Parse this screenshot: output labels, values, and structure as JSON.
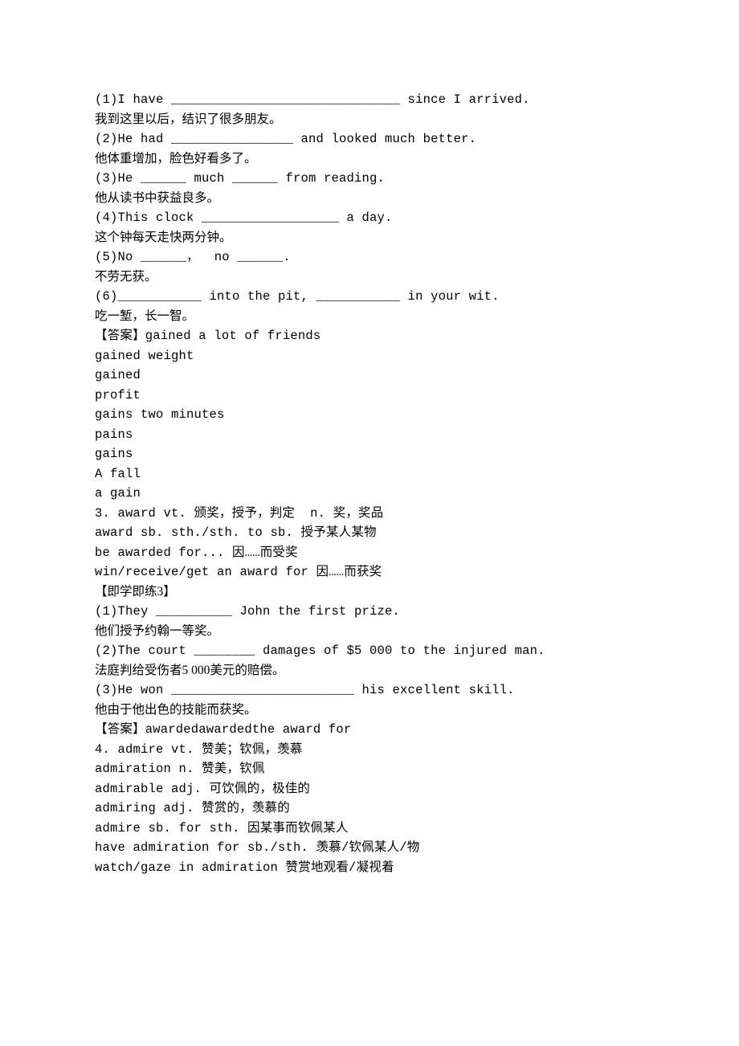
{
  "lines": [
    {
      "text": "(1)I have ______________________________ since I arrived.",
      "cls": "mono"
    },
    {
      "text": "我到这里以后，结识了很多朋友。",
      "cls": "cn"
    },
    {
      "text": "(2)He had ________________ and looked much better.",
      "cls": "mono"
    },
    {
      "text": "他体重增加，脸色好看多了。",
      "cls": "cn"
    },
    {
      "text": "(3)He ______ much ______ from reading.",
      "cls": "mono"
    },
    {
      "text": "他从读书中获益良多。",
      "cls": "cn"
    },
    {
      "text": "(4)This clock __________________ a day.",
      "cls": "mono"
    },
    {
      "text": "这个钟每天走快两分钟。",
      "cls": "cn"
    },
    {
      "text": "(5)No ______，  no ______.",
      "cls": "mono"
    },
    {
      "text": "不劳无获。",
      "cls": "cn"
    },
    {
      "text": "(6)___________ into the pit, ___________ in your wit.",
      "cls": "mono"
    },
    {
      "text": "吃一堑，长一智。",
      "cls": "cn"
    },
    {
      "text": "【答案】gained a lot of friends",
      "cls": "mono"
    },
    {
      "text": "gained weight",
      "cls": "mono"
    },
    {
      "text": "gained",
      "cls": "mono"
    },
    {
      "text": "profit",
      "cls": "mono"
    },
    {
      "text": "gains two minutes",
      "cls": "mono"
    },
    {
      "text": "pains",
      "cls": "mono"
    },
    {
      "text": "gains",
      "cls": "mono"
    },
    {
      "text": "A fall",
      "cls": "mono"
    },
    {
      "text": "a gain",
      "cls": "mono"
    },
    {
      "text": "",
      "cls": "mono"
    },
    {
      "text": "3. award vt. 颁奖，授予，判定  n. 奖，奖品",
      "cls": "mono"
    },
    {
      "text": "award sb. sth./sth. to sb. 授予某人某物",
      "cls": "mono"
    },
    {
      "text": "be awarded for... 因……而受奖",
      "cls": "mono"
    },
    {
      "text": "win/receive/get an award for 因……而获奖",
      "cls": "mono"
    },
    {
      "text": "",
      "cls": "mono"
    },
    {
      "text": "【即学即练3】",
      "cls": "cn"
    },
    {
      "text": "(1)They __________ John the first prize.",
      "cls": "mono"
    },
    {
      "text": "他们授予约翰一等奖。",
      "cls": "cn"
    },
    {
      "text": "(2)The court ________ damages of $5 000 to the injured man.",
      "cls": "mono"
    },
    {
      "text": "法庭判给受伤者5 000美元的赔偿。",
      "cls": "cn"
    },
    {
      "text": "(3)He won ________________________ his excellent skill.",
      "cls": "mono"
    },
    {
      "text": "他由于他出色的技能而获奖。",
      "cls": "cn"
    },
    {
      "text": "【答案】awardedawardedthe award for",
      "cls": "mono"
    },
    {
      "text": "",
      "cls": "mono"
    },
    {
      "text": "4. admire vt. 赞美；钦佩，羡慕",
      "cls": "mono"
    },
    {
      "text": "admiration n. 赞美，钦佩",
      "cls": "mono"
    },
    {
      "text": "admirable adj. 可饮佩的，极佳的",
      "cls": "mono"
    },
    {
      "text": "admiring adj. 赞赏的，羡慕的",
      "cls": "mono"
    },
    {
      "text": "admire sb. for sth. 因某事而钦佩某人",
      "cls": "mono"
    },
    {
      "text": "have admiration for sb./sth. 羡慕/钦佩某人/物",
      "cls": "mono"
    },
    {
      "text": "watch/gaze in admiration 赞赏地观看/凝视着",
      "cls": "mono"
    }
  ]
}
